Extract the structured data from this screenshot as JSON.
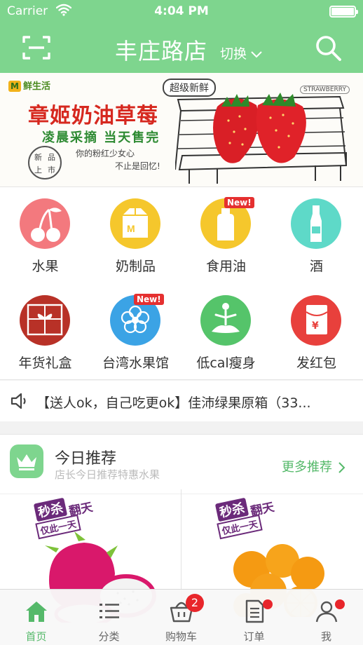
{
  "status_bar": {
    "carrier": "Carrier",
    "time": "4:04 PM"
  },
  "nav": {
    "store_name": "丰庄路店",
    "switch_label": "切换"
  },
  "banner": {
    "brand": "鲜生活",
    "headline": "章姬奶油草莓",
    "subhead": "凌晨采摘 当天售完",
    "badge": "超级新鲜",
    "straw_tag": "STRAWBERRY",
    "seal": [
      "新",
      "品",
      "上",
      "市"
    ],
    "tagline_1": "你的粉红少女心",
    "tagline_2": "不止是回忆!"
  },
  "categories": [
    {
      "label": "水果",
      "color": "#f3797e",
      "icon": "cherry-icon",
      "new": false
    },
    {
      "label": "奶制品",
      "color": "#f5c72c",
      "icon": "milk-carton-icon",
      "new": false
    },
    {
      "label": "食用油",
      "color": "#f5c72c",
      "icon": "oil-bottle-icon",
      "new": true
    },
    {
      "label": "酒",
      "color": "#5ed9c8",
      "icon": "wine-bottle-icon",
      "new": false
    },
    {
      "label": "年货礼盒",
      "color": "#b83127",
      "icon": "gift-box-icon",
      "new": false
    },
    {
      "label": "台湾水果馆",
      "color": "#3ba3e5",
      "icon": "flower-icon",
      "new": true
    },
    {
      "label": "低cal瘦身",
      "color": "#55c46a",
      "icon": "yoga-icon",
      "new": false
    },
    {
      "label": "发红包",
      "color": "#e8403c",
      "icon": "red-envelope-icon",
      "new": false
    }
  ],
  "new_badge": "New!",
  "notice": {
    "text": "【送人ok，自己吃更ok】佳沛绿果原箱（33..."
  },
  "recommend": {
    "title": "今日推荐",
    "subtitle": "店长今日推荐特惠水果",
    "more": "更多推荐",
    "promo_title": "秒杀",
    "promo_sub": "仅此一天",
    "promo_tag": "翻天"
  },
  "tabs": [
    {
      "label": "首页",
      "icon": "home-icon",
      "active": true
    },
    {
      "label": "分类",
      "icon": "list-icon",
      "active": false
    },
    {
      "label": "购物车",
      "icon": "cart-basket-icon",
      "active": false,
      "count": "2"
    },
    {
      "label": "订单",
      "icon": "document-icon",
      "active": false,
      "dot": true
    },
    {
      "label": "我",
      "icon": "user-icon",
      "active": false,
      "dot": true
    }
  ],
  "colors": {
    "primary": "#7ed58e",
    "accent_text": "#55b96a",
    "badge_red": "#e8262b"
  }
}
